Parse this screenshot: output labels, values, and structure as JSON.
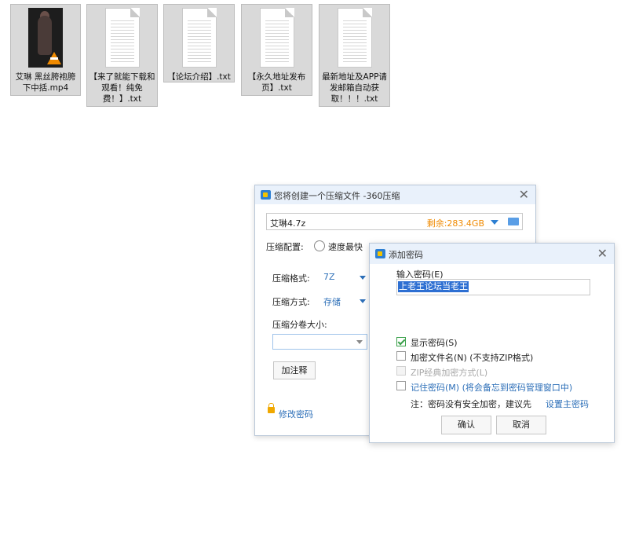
{
  "desktop": {
    "files": [
      {
        "name": "艾琳 黑丝胯袍胯下中括.mp4",
        "type": "video"
      },
      {
        "name": "【来了就能下载和观看！纯免费！】.txt",
        "type": "txt"
      },
      {
        "name": "【论坛介绍】.txt",
        "type": "txt"
      },
      {
        "name": "【永久地址发布页】.txt",
        "type": "txt"
      },
      {
        "name": "最新地址及APP请发邮箱自动获取！！！.txt",
        "type": "txt"
      }
    ]
  },
  "compress_dialog": {
    "title": "您将创建一个压缩文件 -360压缩",
    "filename": "艾琳4.7z",
    "free_space": "剩余:283.4GB",
    "config_label": "压缩配置:",
    "config_option_fast": "速度最快",
    "format_label": "压缩格式:",
    "format_value": "7Z",
    "method_label": "压缩方式:",
    "method_value": "存储",
    "volume_label": "压缩分卷大小:",
    "volume_value": "",
    "comment_button": "加注释",
    "change_password_link": "修改密码",
    "accent_color": "#2d6fb8",
    "free_space_color": "#f08a00"
  },
  "password_dialog": {
    "title": "添加密码",
    "input_label": "输入密码(E)",
    "password_value": "上老王论坛当老王",
    "show_password": {
      "label": "显示密码(S)",
      "checked": true
    },
    "encrypt_filenames": {
      "label": "加密文件名(N) (不支持ZIP格式)",
      "checked": false
    },
    "zip_classic": {
      "label": "ZIP经典加密方式(L)",
      "checked": false,
      "disabled": true
    },
    "remember_password": {
      "label": "记住密码(M) (将会备忘到密码管理窗口中)",
      "checked": false
    },
    "note_prefix": "注：密码没有安全加密，建议先",
    "note_link": "设置主密码",
    "ok_button": "确认",
    "cancel_button": "取消",
    "selection_color": "#2d6fd2"
  },
  "icons": {
    "close": "close-icon",
    "app": "archive-app-icon",
    "folder": "folder-icon",
    "lock": "lock-icon",
    "dropdown": "chevron-down-icon"
  }
}
